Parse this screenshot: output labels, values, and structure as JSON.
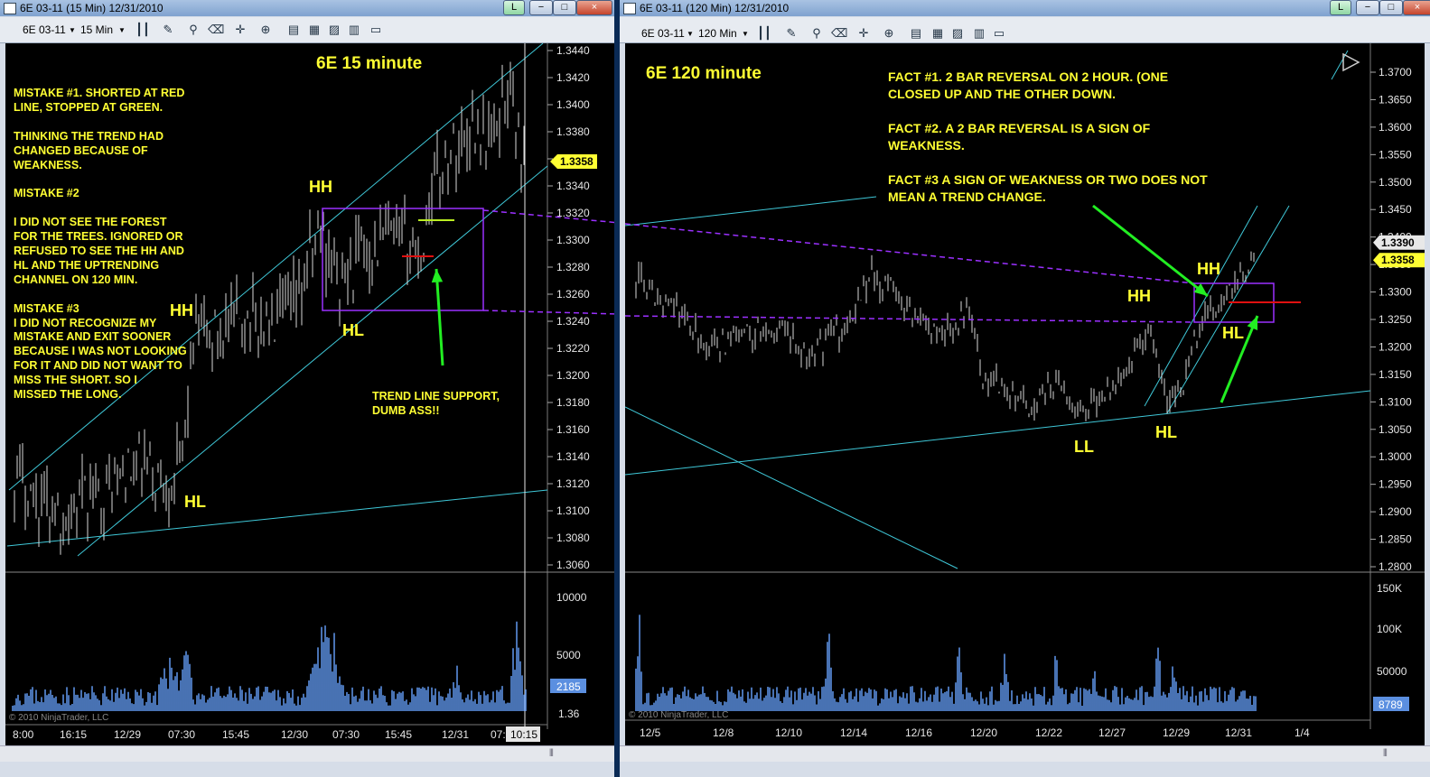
{
  "left": {
    "title": "6E 03-11 (15 Min)  12/31/2010",
    "toolbar": {
      "instrument": "6E 03-11",
      "interval": "15 Min"
    },
    "chart_title": "6E 15 minute",
    "price_axis": [
      "1.3440",
      "1.3420",
      "1.3400",
      "1.3380",
      "1.3360",
      "1.3340",
      "1.3320",
      "1.3300",
      "1.3280",
      "1.3260",
      "1.3240",
      "1.3220",
      "1.3200",
      "1.3180",
      "1.3160",
      "1.3140",
      "1.3120",
      "1.3100",
      "1.3080",
      "1.3060"
    ],
    "current_price": "1.3358",
    "volume_axis": [
      "10000",
      "5000"
    ],
    "volume_last": "2185",
    "volume_marker": "1.36",
    "time_axis": [
      "8:00",
      "16:15",
      "12/29",
      "07:30",
      "15:45",
      "12/30",
      "07:30",
      "15:45",
      "12/31",
      "07:"
    ],
    "time_current": "10:15",
    "copyright": "© 2010 NinjaTrader, LLC",
    "notes": "MISTAKE #1. SHORTED AT RED\nLINE, STOPPED AT GREEN.\n\nTHINKING THE TREND HAD\nCHANGED BECAUSE OF\nWEAKNESS.\n\nMISTAKE #2\n\nI DID NOT SEE THE FOREST\nFOR THE TREES.  IGNORED OR\nREFUSED TO SEE THE HH AND\nHL AND THE UPTRENDING\nCHANNEL ON 120 MIN.\n\nMISTAKE #3\nI DID NOT RECOGNIZE MY\nMISTAKE AND EXIT SOONER\nBECAUSE I WAS NOT LOOKING\nFOR IT AND DID NOT WANT TO\nMISS THE SHORT.  SO I\nMISSED THE LONG.",
    "support_note": "TREND LINE SUPPORT,\nDUMB ASS!!",
    "labels": {
      "hh_top": "HH",
      "hh_left": "HH",
      "hl_mid": "HL",
      "hl_left": "HL"
    }
  },
  "right": {
    "title": "6E 03-11 (120 Min)  12/31/2010",
    "toolbar": {
      "instrument": "6E 03-11",
      "interval": "120 Min"
    },
    "chart_title": "6E 120 minute",
    "price_axis": [
      "1.3700",
      "1.3650",
      "1.3600",
      "1.3550",
      "1.3500",
      "1.3450",
      "1.3400",
      "1.3350",
      "1.3300",
      "1.3250",
      "1.3200",
      "1.3150",
      "1.3100",
      "1.3050",
      "1.3000",
      "1.2950",
      "1.2900",
      "1.2850",
      "1.2800"
    ],
    "price_badge_1": "1.3390",
    "price_badge_2": "1.3358",
    "volume_axis": [
      "150K",
      "100K",
      "50000"
    ],
    "volume_last": "8789",
    "time_axis": [
      "12/5",
      "12/8",
      "12/10",
      "12/14",
      "12/16",
      "12/20",
      "12/22",
      "12/27",
      "12/29",
      "12/31",
      "1/4"
    ],
    "copyright": "© 2010 NinjaTrader, LLC",
    "facts": "FACT #1.  2 BAR REVERSAL ON 2 HOUR.   (ONE\nCLOSED UP AND THE OTHER DOWN.\n\nFACT #2.  A 2 BAR REVERSAL IS A SIGN OF\nWEAKNESS.\n\nFACT #3  A SIGN OF WEAKNESS OR TWO DOES NOT\nMEAN A TREND CHANGE.",
    "labels": {
      "hh_right": "HH",
      "hh_mid": "HH",
      "hl_right": "HL",
      "hl_mid": "HL",
      "ll": "LL"
    }
  },
  "window_buttons": {
    "link": "L",
    "min": "−",
    "max": "□",
    "close": "×"
  },
  "colors": {
    "accent_yellow": "#ffff33",
    "channel": "#3fc8d8",
    "box": "#9b30ff",
    "arrow": "#22ee22",
    "stop": "#e01010",
    "volume": "#5b8fe0"
  }
}
